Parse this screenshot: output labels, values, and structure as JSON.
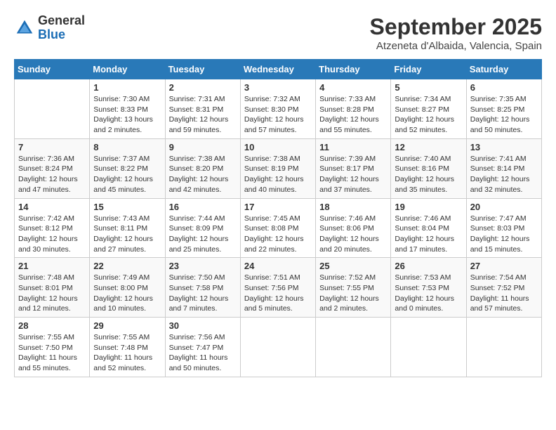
{
  "header": {
    "logo_general": "General",
    "logo_blue": "Blue",
    "month_title": "September 2025",
    "location": "Atzeneta d'Albaida, Valencia, Spain"
  },
  "weekdays": [
    "Sunday",
    "Monday",
    "Tuesday",
    "Wednesday",
    "Thursday",
    "Friday",
    "Saturday"
  ],
  "weeks": [
    [
      {
        "day": "",
        "content": ""
      },
      {
        "day": "1",
        "content": "Sunrise: 7:30 AM\nSunset: 8:33 PM\nDaylight: 13 hours\nand 2 minutes."
      },
      {
        "day": "2",
        "content": "Sunrise: 7:31 AM\nSunset: 8:31 PM\nDaylight: 12 hours\nand 59 minutes."
      },
      {
        "day": "3",
        "content": "Sunrise: 7:32 AM\nSunset: 8:30 PM\nDaylight: 12 hours\nand 57 minutes."
      },
      {
        "day": "4",
        "content": "Sunrise: 7:33 AM\nSunset: 8:28 PM\nDaylight: 12 hours\nand 55 minutes."
      },
      {
        "day": "5",
        "content": "Sunrise: 7:34 AM\nSunset: 8:27 PM\nDaylight: 12 hours\nand 52 minutes."
      },
      {
        "day": "6",
        "content": "Sunrise: 7:35 AM\nSunset: 8:25 PM\nDaylight: 12 hours\nand 50 minutes."
      }
    ],
    [
      {
        "day": "7",
        "content": "Sunrise: 7:36 AM\nSunset: 8:24 PM\nDaylight: 12 hours\nand 47 minutes."
      },
      {
        "day": "8",
        "content": "Sunrise: 7:37 AM\nSunset: 8:22 PM\nDaylight: 12 hours\nand 45 minutes."
      },
      {
        "day": "9",
        "content": "Sunrise: 7:38 AM\nSunset: 8:20 PM\nDaylight: 12 hours\nand 42 minutes."
      },
      {
        "day": "10",
        "content": "Sunrise: 7:38 AM\nSunset: 8:19 PM\nDaylight: 12 hours\nand 40 minutes."
      },
      {
        "day": "11",
        "content": "Sunrise: 7:39 AM\nSunset: 8:17 PM\nDaylight: 12 hours\nand 37 minutes."
      },
      {
        "day": "12",
        "content": "Sunrise: 7:40 AM\nSunset: 8:16 PM\nDaylight: 12 hours\nand 35 minutes."
      },
      {
        "day": "13",
        "content": "Sunrise: 7:41 AM\nSunset: 8:14 PM\nDaylight: 12 hours\nand 32 minutes."
      }
    ],
    [
      {
        "day": "14",
        "content": "Sunrise: 7:42 AM\nSunset: 8:12 PM\nDaylight: 12 hours\nand 30 minutes."
      },
      {
        "day": "15",
        "content": "Sunrise: 7:43 AM\nSunset: 8:11 PM\nDaylight: 12 hours\nand 27 minutes."
      },
      {
        "day": "16",
        "content": "Sunrise: 7:44 AM\nSunset: 8:09 PM\nDaylight: 12 hours\nand 25 minutes."
      },
      {
        "day": "17",
        "content": "Sunrise: 7:45 AM\nSunset: 8:08 PM\nDaylight: 12 hours\nand 22 minutes."
      },
      {
        "day": "18",
        "content": "Sunrise: 7:46 AM\nSunset: 8:06 PM\nDaylight: 12 hours\nand 20 minutes."
      },
      {
        "day": "19",
        "content": "Sunrise: 7:46 AM\nSunset: 8:04 PM\nDaylight: 12 hours\nand 17 minutes."
      },
      {
        "day": "20",
        "content": "Sunrise: 7:47 AM\nSunset: 8:03 PM\nDaylight: 12 hours\nand 15 minutes."
      }
    ],
    [
      {
        "day": "21",
        "content": "Sunrise: 7:48 AM\nSunset: 8:01 PM\nDaylight: 12 hours\nand 12 minutes."
      },
      {
        "day": "22",
        "content": "Sunrise: 7:49 AM\nSunset: 8:00 PM\nDaylight: 12 hours\nand 10 minutes."
      },
      {
        "day": "23",
        "content": "Sunrise: 7:50 AM\nSunset: 7:58 PM\nDaylight: 12 hours\nand 7 minutes."
      },
      {
        "day": "24",
        "content": "Sunrise: 7:51 AM\nSunset: 7:56 PM\nDaylight: 12 hours\nand 5 minutes."
      },
      {
        "day": "25",
        "content": "Sunrise: 7:52 AM\nSunset: 7:55 PM\nDaylight: 12 hours\nand 2 minutes."
      },
      {
        "day": "26",
        "content": "Sunrise: 7:53 AM\nSunset: 7:53 PM\nDaylight: 12 hours\nand 0 minutes."
      },
      {
        "day": "27",
        "content": "Sunrise: 7:54 AM\nSunset: 7:52 PM\nDaylight: 11 hours\nand 57 minutes."
      }
    ],
    [
      {
        "day": "28",
        "content": "Sunrise: 7:55 AM\nSunset: 7:50 PM\nDaylight: 11 hours\nand 55 minutes."
      },
      {
        "day": "29",
        "content": "Sunrise: 7:55 AM\nSunset: 7:48 PM\nDaylight: 11 hours\nand 52 minutes."
      },
      {
        "day": "30",
        "content": "Sunrise: 7:56 AM\nSunset: 7:47 PM\nDaylight: 11 hours\nand 50 minutes."
      },
      {
        "day": "",
        "content": ""
      },
      {
        "day": "",
        "content": ""
      },
      {
        "day": "",
        "content": ""
      },
      {
        "day": "",
        "content": ""
      }
    ]
  ]
}
